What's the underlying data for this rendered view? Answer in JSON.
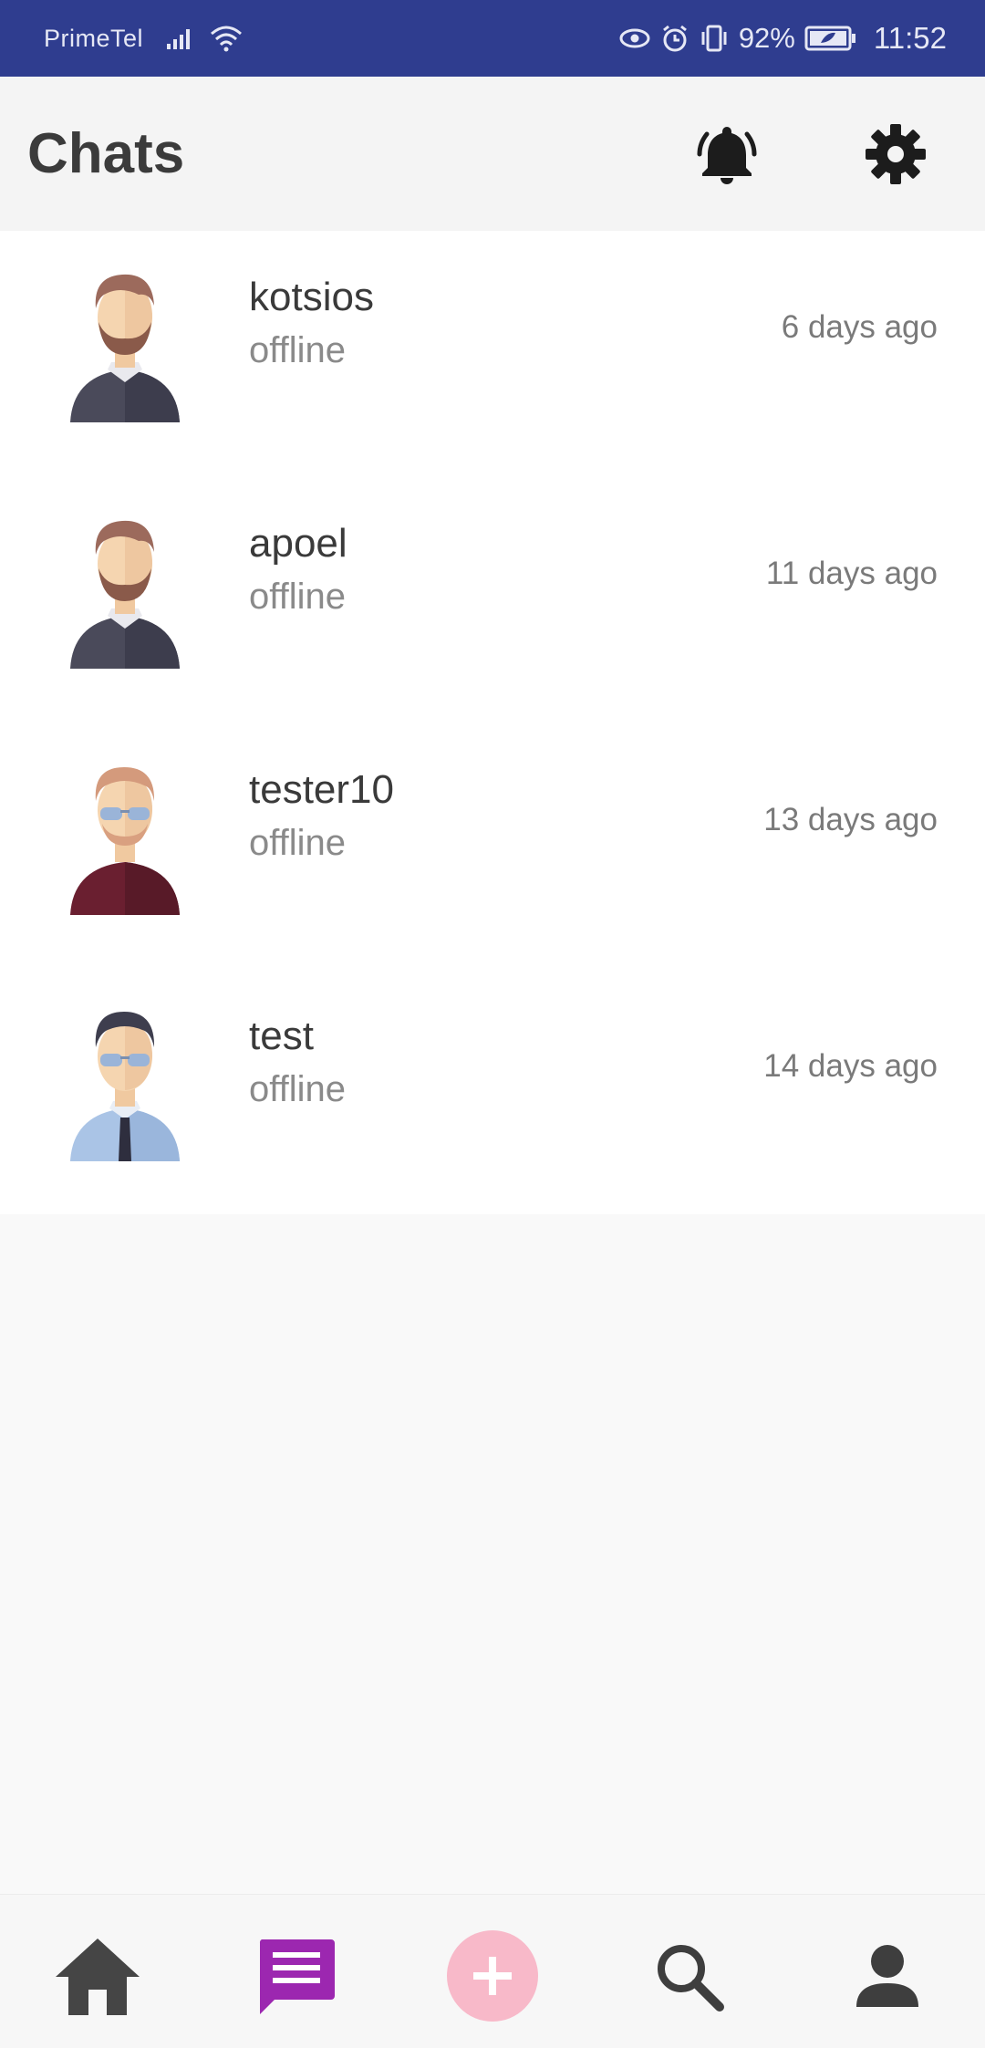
{
  "status_bar": {
    "carrier": "PrimeTel",
    "battery": "92%",
    "time": "11:52"
  },
  "header": {
    "title": "Chats",
    "bell_icon": "bell-icon",
    "settings_icon": "gear-icon"
  },
  "chats": [
    {
      "name": "kotsios",
      "status": "offline",
      "time": "6 days ago",
      "avatar": "bearded-man-avatar"
    },
    {
      "name": "apoel",
      "status": "offline",
      "time": "11 days ago",
      "avatar": "bearded-man-avatar"
    },
    {
      "name": "tester10",
      "status": "offline",
      "time": "13 days ago",
      "avatar": "sunglasses-man-avatar"
    },
    {
      "name": "test",
      "status": "offline",
      "time": "14 days ago",
      "avatar": "tie-man-avatar"
    }
  ],
  "bottom_nav": {
    "items": [
      "home-icon",
      "chat-icon",
      "add-icon",
      "search-icon",
      "profile-icon"
    ],
    "active_color": "#9c27b0",
    "add_color": "#f8b9c9"
  },
  "colors": {
    "status_bar": "#2f3d8f",
    "header_bg": "#f4f4f4"
  }
}
